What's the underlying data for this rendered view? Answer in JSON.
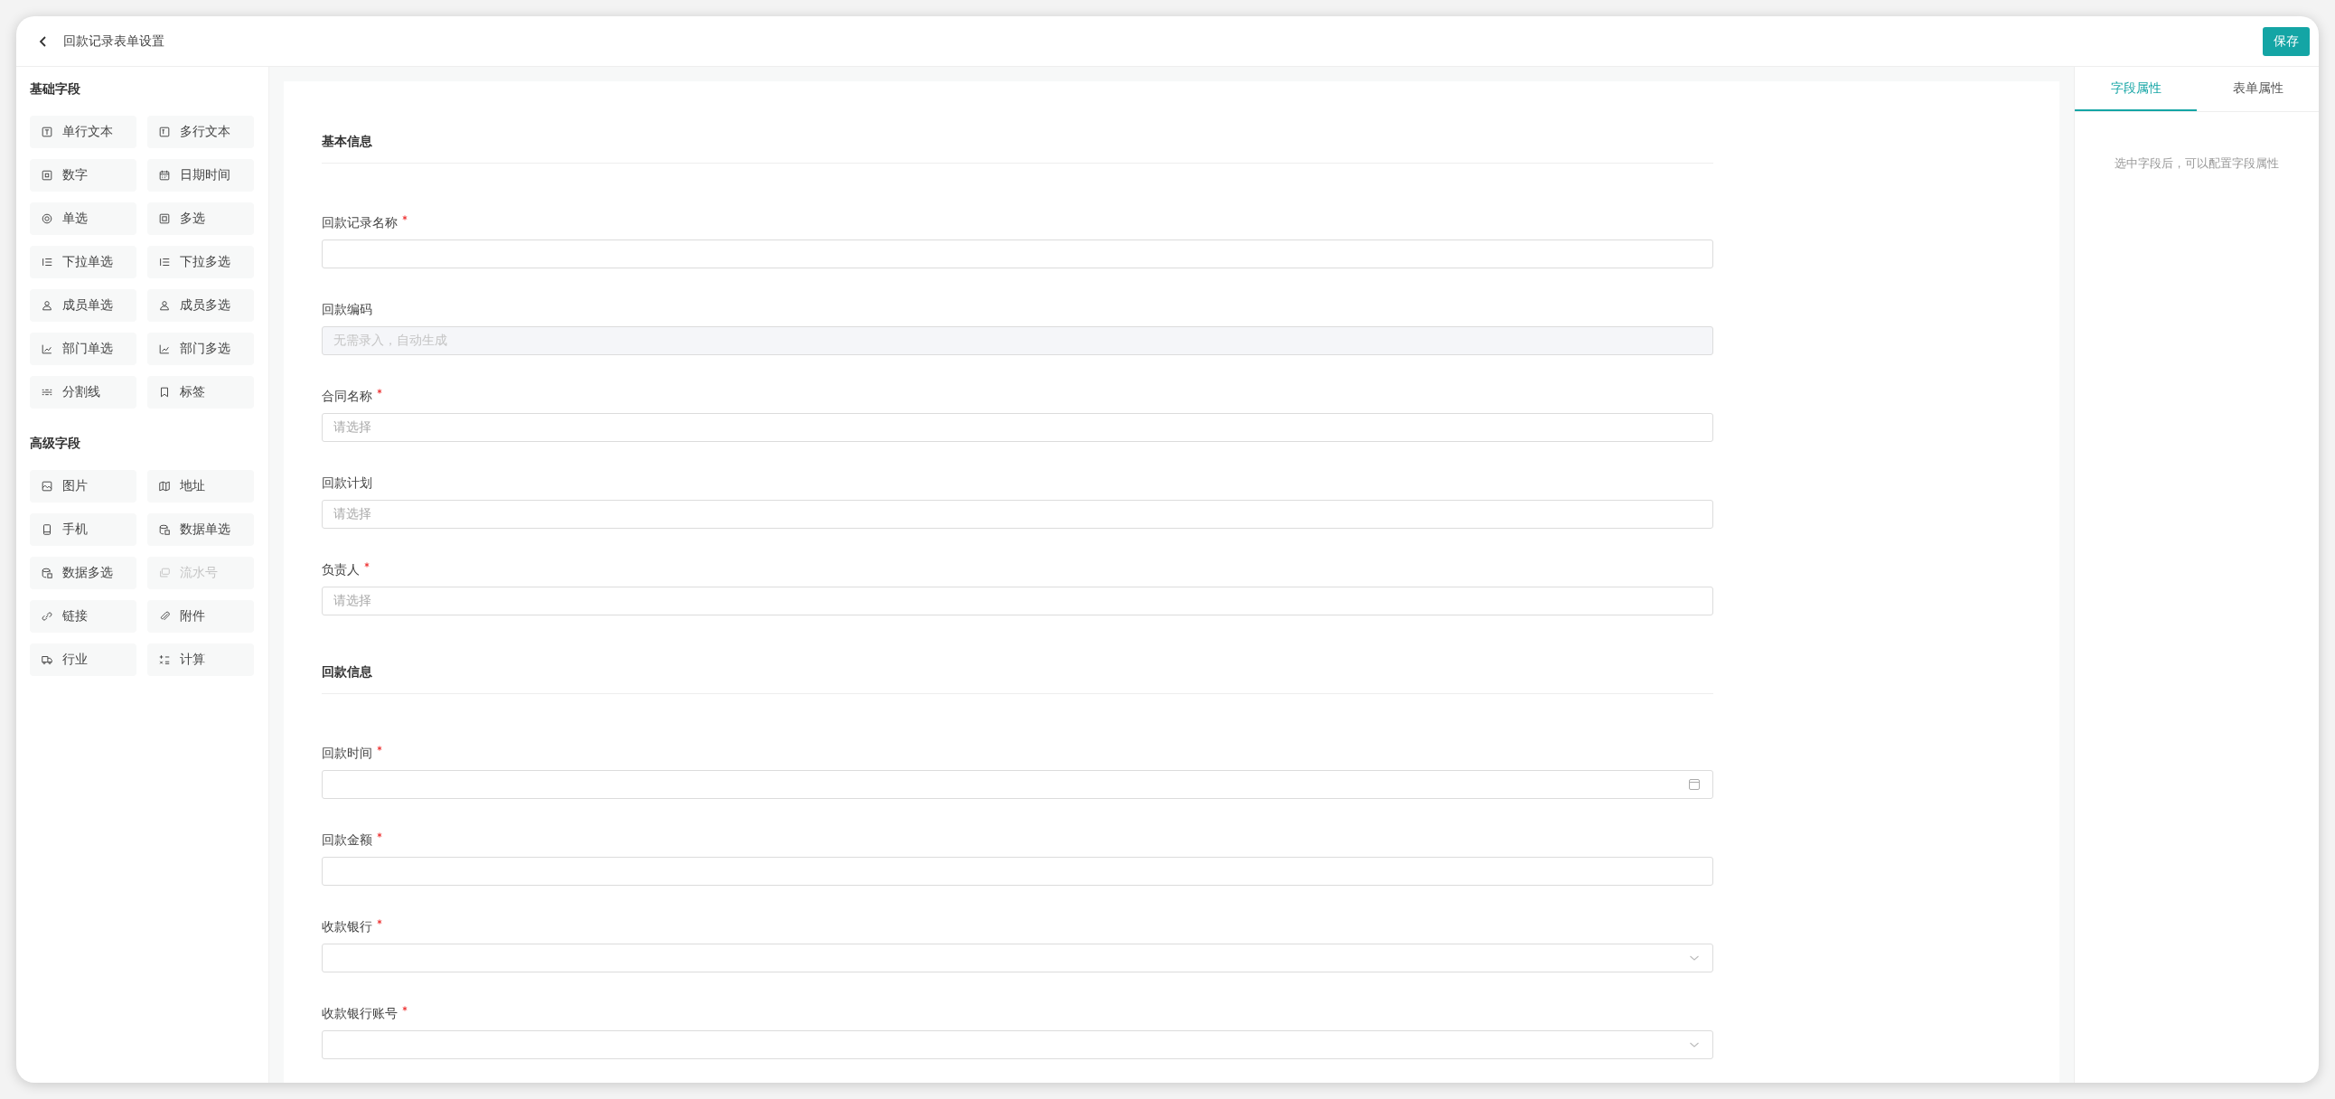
{
  "header": {
    "title": "回款记录表单设置",
    "save_button": "保存"
  },
  "palette": [
    {
      "title": "基础字段",
      "items": [
        {
          "label": "单行文本",
          "disabled": false
        },
        {
          "label": "多行文本",
          "disabled": false
        },
        {
          "label": "数字",
          "disabled": false
        },
        {
          "label": "日期时间",
          "disabled": false
        },
        {
          "label": "单选",
          "disabled": false
        },
        {
          "label": "多选",
          "disabled": false
        },
        {
          "label": "下拉单选",
          "disabled": false
        },
        {
          "label": "下拉多选",
          "disabled": false
        },
        {
          "label": "成员单选",
          "disabled": false
        },
        {
          "label": "成员多选",
          "disabled": false
        },
        {
          "label": "部门单选",
          "disabled": false
        },
        {
          "label": "部门多选",
          "disabled": false
        },
        {
          "label": "分割线",
          "disabled": false
        },
        {
          "label": "标签",
          "disabled": false
        }
      ]
    },
    {
      "title": "高级字段",
      "items": [
        {
          "label": "图片",
          "disabled": false
        },
        {
          "label": "地址",
          "disabled": false
        },
        {
          "label": "手机",
          "disabled": false
        },
        {
          "label": "数据单选",
          "disabled": false
        },
        {
          "label": "数据多选",
          "disabled": false
        },
        {
          "label": "流水号",
          "disabled": true
        },
        {
          "label": "链接",
          "disabled": false
        },
        {
          "label": "附件",
          "disabled": false
        },
        {
          "label": "行业",
          "disabled": false
        },
        {
          "label": "计算",
          "disabled": false
        }
      ]
    }
  ],
  "form": {
    "sections": [
      {
        "title": "基本信息",
        "fields": [
          {
            "label": "回款记录名称",
            "required": true,
            "kind": "text"
          },
          {
            "label": "回款编码",
            "required": false,
            "kind": "disabled",
            "placeholder": "无需录入，自动生成"
          },
          {
            "label": "合同名称",
            "required": true,
            "kind": "text",
            "placeholder": "请选择"
          },
          {
            "label": "回款计划",
            "required": false,
            "kind": "text",
            "placeholder": "请选择"
          },
          {
            "label": "负责人",
            "required": true,
            "kind": "text",
            "placeholder": "请选择"
          }
        ]
      },
      {
        "title": "回款信息",
        "fields": [
          {
            "label": "回款时间",
            "required": true,
            "kind": "date"
          },
          {
            "label": "回款金额",
            "required": true,
            "kind": "text"
          },
          {
            "label": "收款银行",
            "required": true,
            "kind": "select"
          },
          {
            "label": "收款银行账号",
            "required": true,
            "kind": "select"
          }
        ]
      }
    ]
  },
  "properties": {
    "tabs": [
      {
        "label": "字段属性",
        "selected": true
      },
      {
        "label": "表单属性",
        "selected": false
      }
    ],
    "hint": "选中字段后，可以配置字段属性"
  }
}
